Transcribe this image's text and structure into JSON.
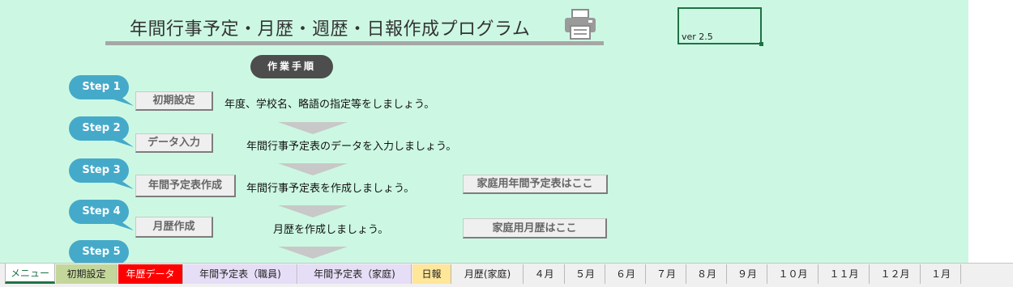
{
  "header": {
    "title": "年間行事予定・月歴・週歴・日報作成プログラム",
    "version": "ver 2.5",
    "procedure_label": "作業手順"
  },
  "steps": [
    {
      "label": "Step 1",
      "button": "初期設定",
      "description": "年度、学校名、略語の指定等をしましょう。"
    },
    {
      "label": "Step 2",
      "button": "データ入力",
      "description": "年間行事予定表のデータを入力しましょう。"
    },
    {
      "label": "Step 3",
      "button": "年間予定表作成",
      "description": "年間行事予定表を作成しましょう。",
      "extra_button": "家庭用年間予定表はここ"
    },
    {
      "label": "Step 4",
      "button": "月歴作成",
      "description": "月歴を作成しましょう。",
      "extra_button": "家庭用月歴はここ"
    },
    {
      "label": "Step 5"
    }
  ],
  "colors": {
    "sheet_background": "#ccf8e3",
    "step_bubble": "#45aac9",
    "procedure_pill": "#4d4d4d",
    "tab_active": "#1f7244"
  },
  "sheet_tabs": [
    {
      "label": "メニュー",
      "color": "#ffffff",
      "active": true
    },
    {
      "label": "初期設定",
      "color": "#c4d79b"
    },
    {
      "label": "年歴データ",
      "color": "#ff0000",
      "text_color": "#ffffff"
    },
    {
      "label": "年間予定表（職員)",
      "color": "#e6ddf7"
    },
    {
      "label": "年間予定表（家庭)",
      "color": "#e6ddf7"
    },
    {
      "label": "日報",
      "color": "#ffe699"
    },
    {
      "label": "月歴(家庭)",
      "color": "#f0f0f0"
    },
    {
      "label": "４月",
      "color": "#f0f0f0"
    },
    {
      "label": "５月",
      "color": "#f0f0f0"
    },
    {
      "label": "６月",
      "color": "#f0f0f0"
    },
    {
      "label": "７月",
      "color": "#f0f0f0"
    },
    {
      "label": "８月",
      "color": "#f0f0f0"
    },
    {
      "label": "９月",
      "color": "#f0f0f0"
    },
    {
      "label": "１０月",
      "color": "#f0f0f0"
    },
    {
      "label": "１１月",
      "color": "#f0f0f0"
    },
    {
      "label": "１２月",
      "color": "#f0f0f0"
    },
    {
      "label": "１月",
      "color": "#f0f0f0"
    }
  ],
  "icons": {
    "printer": "printer-icon"
  }
}
